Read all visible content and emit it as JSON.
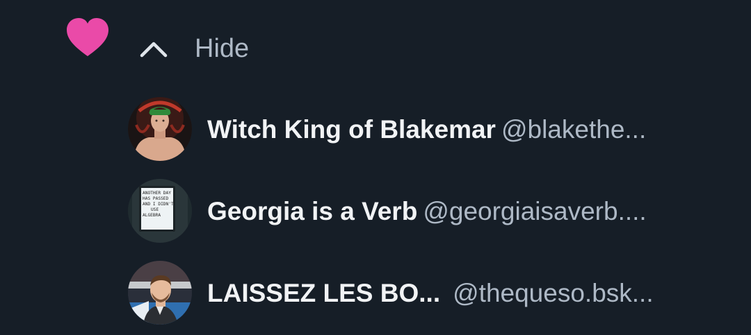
{
  "like": {
    "icon": "heart-filled-icon",
    "color": "#ea4aa8"
  },
  "toggle": {
    "icon": "chevron-up-icon",
    "label": "Hide"
  },
  "users": [
    {
      "display_name": "Witch King of Blakemar",
      "handle": "@blakethe..."
    },
    {
      "display_name": "Georgia is a Verb",
      "handle": "@georgiaisaverb...."
    },
    {
      "display_name": "LAISSEZ LES BO...",
      "handle": "@thequeso.bsk..."
    }
  ],
  "avatar_sign_text": [
    "ANOTHER DAY",
    "HAS PASSED",
    "AND I DIDN'T",
    "USE",
    "ALGEBRA"
  ]
}
